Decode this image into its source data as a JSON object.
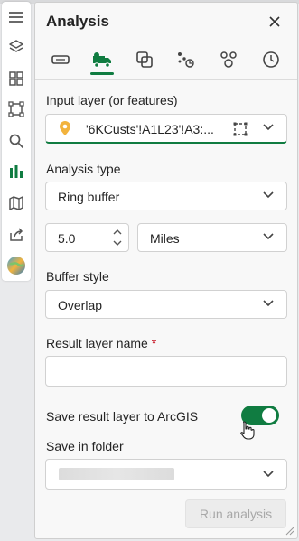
{
  "toolbar": {
    "items": [
      {
        "icon": "hamburger-menu-icon"
      },
      {
        "icon": "layers-icon"
      },
      {
        "icon": "basemap-gallery-icon"
      },
      {
        "icon": "select-rectangle-icon"
      },
      {
        "icon": "search-icon"
      },
      {
        "icon": "analysis-bar-chart-icon",
        "active": true
      },
      {
        "icon": "map-icon"
      },
      {
        "icon": "share-icon"
      },
      {
        "icon": "globe-icon"
      }
    ]
  },
  "panel": {
    "title": "Analysis",
    "close_icon": "close-icon",
    "tabs": [
      {
        "icon": "buffer-tab-icon"
      },
      {
        "icon": "delivery-truck-tab-icon",
        "active": true
      },
      {
        "icon": "overlay-tab-icon"
      },
      {
        "icon": "route-points-tab-icon"
      },
      {
        "icon": "cluster-tab-icon"
      },
      {
        "icon": "clock-tab-icon"
      }
    ]
  },
  "input_layer": {
    "label": "Input layer (or features)",
    "value": "'6KCusts'!A1L23'!A3:..."
  },
  "analysis_type": {
    "label": "Analysis type",
    "value": "Ring buffer"
  },
  "distance": {
    "value": "5.0",
    "unit": "Miles"
  },
  "buffer_style": {
    "label": "Buffer style",
    "value": "Overlap"
  },
  "result_layer": {
    "label": "Result layer name",
    "required_marker": "*",
    "value": ""
  },
  "save_to_arcgis": {
    "label": "Save result layer to ArcGIS",
    "on": true
  },
  "save_folder": {
    "label": "Save in folder"
  },
  "run_button": {
    "label": "Run analysis",
    "enabled": false
  },
  "colors": {
    "accent": "#107c41",
    "required": "#c50f1f"
  }
}
